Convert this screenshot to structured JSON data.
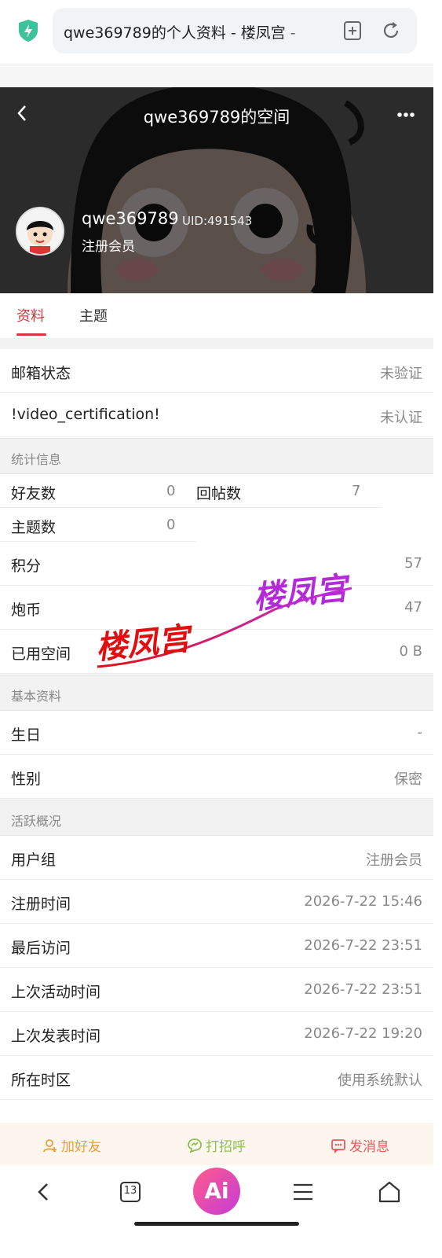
{
  "browser": {
    "url_title": "qwe369789的个人资料 - 楼凤宫 -",
    "tab_count": "13",
    "ai_label": "Ai"
  },
  "header": {
    "title": "qwe369789的空间",
    "username": "qwe369789",
    "uid": "UID:491543",
    "group": "注册会员"
  },
  "tabs": [
    {
      "label": "资料",
      "active": true
    },
    {
      "label": "主题",
      "active": false
    }
  ],
  "basic_top": [
    {
      "label": "邮箱状态",
      "value": "未验证"
    },
    {
      "label": "!video_certification!",
      "value": "未认证"
    }
  ],
  "stats": {
    "section": "统计信息",
    "friends_label": "好友数",
    "friends_value": "0",
    "replies_label": "回帖数",
    "replies_value": "7",
    "threads_label": "主题数",
    "threads_value": "0",
    "rows": [
      {
        "label": "积分",
        "value": "57"
      },
      {
        "label": "炮币",
        "value": "47"
      },
      {
        "label": "已用空间",
        "value": "0 B"
      }
    ]
  },
  "basic": {
    "section": "基本资料",
    "rows": [
      {
        "label": "生日",
        "value": "-"
      },
      {
        "label": "性别",
        "value": "保密"
      }
    ]
  },
  "activity": {
    "section": "活跃概况",
    "rows": [
      {
        "label": "用户组",
        "value": "注册会员"
      },
      {
        "label": "注册时间",
        "value": "2026-7-22 15:46"
      },
      {
        "label": "最后访问",
        "value": "2026-7-22 23:51"
      },
      {
        "label": "上次活动时间",
        "value": "2026-7-22 23:51"
      },
      {
        "label": "上次发表时间",
        "value": "2026-7-22 19:20"
      },
      {
        "label": "所在时区",
        "value": "使用系统默认"
      }
    ]
  },
  "watermark": {
    "text_1": "楼凤宫",
    "text_2": "楼凤宫"
  },
  "actions": {
    "add_friend": "加好友",
    "say_hi": "打招呼",
    "send_msg": "发消息"
  },
  "colors": {
    "accent": "#d0393e",
    "action_add": "#e8a03a",
    "action_hi": "#8cc152",
    "action_msg": "#e8585c"
  }
}
